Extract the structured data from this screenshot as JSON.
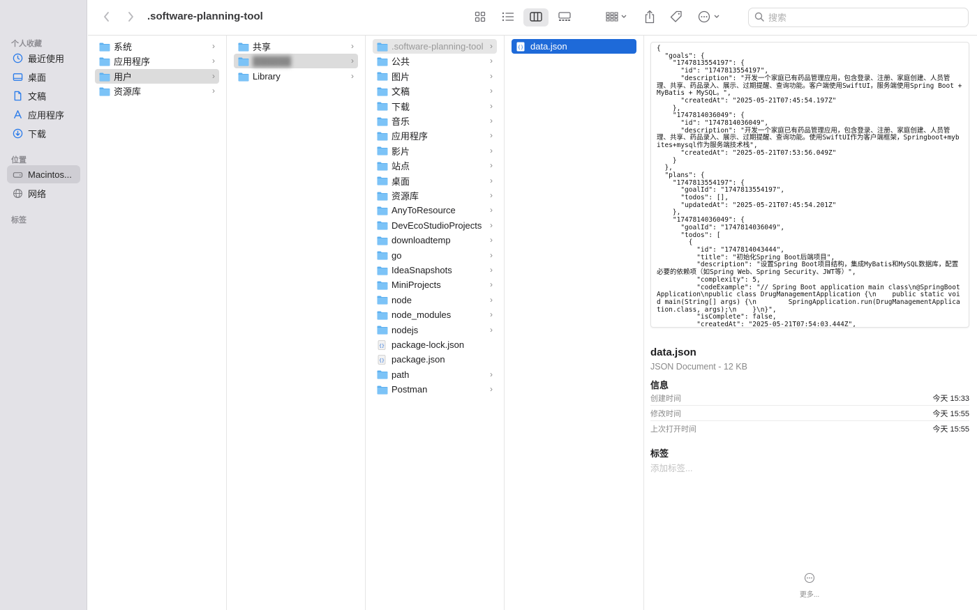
{
  "sidebar": {
    "favorites_title": "个人收藏",
    "favorites": [
      "最近使用",
      "桌面",
      "文稿",
      "应用程序",
      "下载"
    ],
    "locations_title": "位置",
    "locations": [
      "Macintos...",
      "网络"
    ],
    "tags_title": "标签"
  },
  "toolbar": {
    "title": ".software-planning-tool",
    "search_placeholder": "搜索"
  },
  "columns": {
    "col1": [
      "系统",
      "应用程序",
      "用户",
      "资源库"
    ],
    "col2": [
      "共享",
      "██████",
      "Library"
    ],
    "col3": [
      ".software-planning-tool",
      "公共",
      "图片",
      "文稿",
      "下载",
      "音乐",
      "应用程序",
      "影片",
      "站点",
      "桌面",
      "资源库",
      "AnyToResource",
      "DevEcoStudioProjects",
      "downloadtemp",
      "go",
      "IdeaSnapshots",
      "MiniProjects",
      "node",
      "node_modules",
      "nodejs",
      "package-lock.json",
      "package.json",
      "path",
      "Postman"
    ],
    "col4": [
      "data.json"
    ]
  },
  "preview": {
    "code": "{\n  \"goals\": {\n    \"1747813554197\": {\n      \"id\": \"1747813554197\",\n      \"description\": \"开发一个家庭已有药品管理应用，包含登录、注册、家庭创建、人员管理、共享、药品录入、展示、过期提醒、查询功能。客户端使用SwiftUI，服务端使用Spring Boot + MyBatis + MySQL。\",\n      \"createdAt\": \"2025-05-21T07:45:54.197Z\"\n    },\n    \"1747814036049\": {\n      \"id\": \"1747814036049\",\n      \"description\": \"开发一个家庭已有药品管理应用，包含登录、注册、家庭创建、人员管理、共享、药品录入、展示、过期提醒、查询功能。使用SwiftUI作为客户端框架，Springboot+mybites+mysql作为服务端技术栈\",\n      \"createdAt\": \"2025-05-21T07:53:56.049Z\"\n    }\n  },\n  \"plans\": {\n    \"1747813554197\": {\n      \"goalId\": \"1747813554197\",\n      \"todos\": [],\n      \"updatedAt\": \"2025-05-21T07:45:54.201Z\"\n    },\n    \"1747814036049\": {\n      \"goalId\": \"1747814036049\",\n      \"todos\": [\n        {\n          \"id\": \"1747814043444\",\n          \"title\": \"初始化Spring Boot后端项目\",\n          \"description\": \"设置Spring Boot项目结构，集成MyBatis和MySQL数据库，配置必要的依赖项（如Spring Web、Spring Security、JWT等）\",\n          \"complexity\": 5,\n          \"codeExample\": \"// Spring Boot application main class\\n@SpringBootApplication\\npublic class DrugManagementApplication {\\n    public static void main(String[] args) {\\n        SpringApplication.run(DrugManagementApplication.class, args);\\n    }\\n}\",\n          \"isComplete\": false,\n          \"createdAt\": \"2025-05-21T07:54:03.444Z\",",
    "file_name": "data.json",
    "file_kind": "JSON Document - 12 KB",
    "info_title": "信息",
    "info": [
      {
        "label": "创建时间",
        "value": "今天 15:33"
      },
      {
        "label": "修改时间",
        "value": "今天 15:55"
      },
      {
        "label": "上次打开时间",
        "value": "今天 15:55"
      }
    ],
    "tags_title": "标签",
    "tags_placeholder": "添加标签...",
    "more_label": "更多..."
  }
}
